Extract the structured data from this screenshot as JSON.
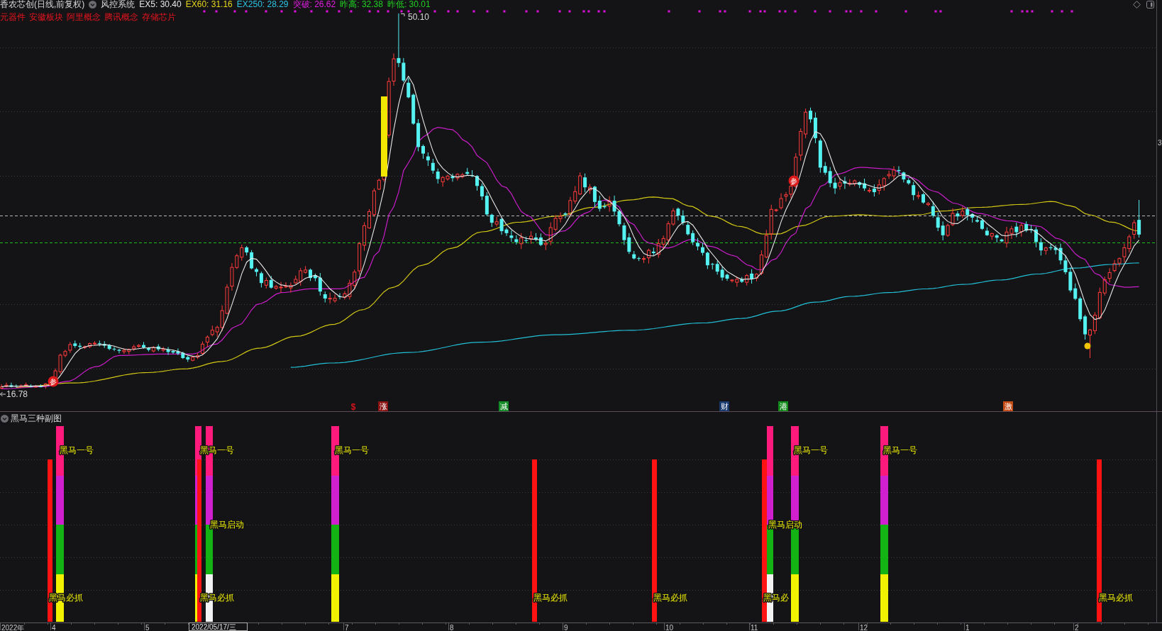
{
  "header": {
    "title": "香农芯创(日线,前复权)",
    "system": "风控系统",
    "indicators": [
      {
        "text": "EX5: 30.40",
        "color": "#e6e6e6"
      },
      {
        "text": "EX60: 31.16",
        "color": "#e6d61c"
      },
      {
        "text": "EX250: 28.29",
        "color": "#2cc6e6"
      },
      {
        "text": "突破: 26.62",
        "color": "#e01ee0"
      },
      {
        "text": "昨高: 32.38",
        "color": "#20d020"
      },
      {
        "text": "昨低: 30.01",
        "color": "#20d020"
      }
    ],
    "concepts": [
      "元器件",
      "安徽板块",
      "阿里概念",
      "腾讯概念",
      "存储芯片"
    ]
  },
  "chart": {
    "high_label": "50.10",
    "low_label": "16.78",
    "axis_label": "3",
    "markers": [
      {
        "text": "参"
      },
      {
        "text": "参"
      }
    ],
    "event_tags": [
      {
        "kind": "plain",
        "text": "$",
        "color": "#d8141a"
      },
      {
        "kind": "badge",
        "text": "涨",
        "color": "#8a1212"
      },
      {
        "kind": "badge",
        "text": "减",
        "color": "#148a26"
      },
      {
        "kind": "badge",
        "text": "财",
        "color": "#17396e"
      },
      {
        "kind": "badge",
        "text": "港",
        "color": "#128a1a"
      },
      {
        "kind": "badge",
        "text": "激",
        "color": "#c44a14"
      }
    ]
  },
  "subchart": {
    "title": "黑马三种副图",
    "signals": [
      {
        "labels": [
          {
            "kind": "upper",
            "text": "黑马一号"
          },
          {
            "kind": "lower",
            "text": "黑马必抓"
          }
        ]
      },
      {
        "labels": [
          {
            "kind": "upper",
            "text": "黑马一号"
          },
          {
            "kind": "middle",
            "text": "黑马启动"
          },
          {
            "kind": "lower",
            "text": "黑马必抓"
          }
        ]
      },
      {
        "labels": [
          {
            "kind": "upper",
            "text": "黑马一号"
          }
        ]
      },
      {
        "labels": [
          {
            "kind": "lower",
            "text": "黑马必抓"
          }
        ]
      },
      {
        "labels": [
          {
            "kind": "lower",
            "text": "黑马必抓"
          }
        ]
      },
      {
        "labels": [
          {
            "kind": "middle",
            "text": "黑马启动"
          },
          {
            "kind": "lower",
            "text": "黑马必"
          }
        ]
      },
      {
        "labels": [
          {
            "kind": "upper",
            "text": "黑马一号"
          }
        ]
      },
      {
        "labels": [
          {
            "kind": "upper",
            "text": "黑马一号"
          }
        ]
      },
      {
        "labels": [
          {
            "kind": "lower",
            "text": "黑马必抓"
          }
        ]
      }
    ]
  },
  "time_axis": {
    "labels": [
      "2022年",
      "4",
      "5",
      "7",
      "8",
      "9",
      "10",
      "11",
      "12",
      "1",
      "2"
    ],
    "cursor_date": "2022/05/17/三"
  }
}
